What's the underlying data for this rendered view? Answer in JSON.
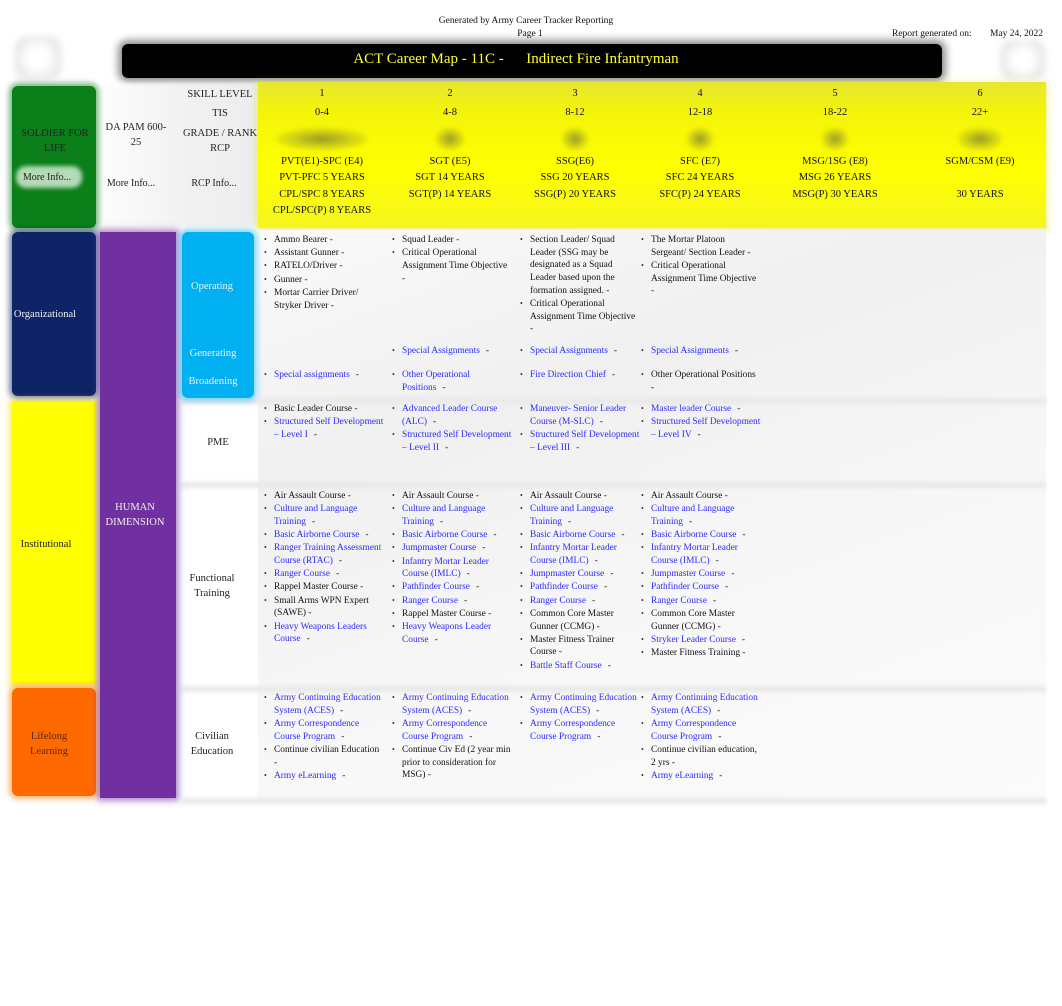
{
  "header": {
    "generated_by": "Generated by Army Career Tracker Reporting",
    "page": "Page 1",
    "report_generated_label": "Report generated on:",
    "report_date": "May 24, 2022",
    "title": "ACT Career Map - 11C -      Indirect Fire Infantryman"
  },
  "left_panel": {
    "soldier_for_life": "SOLDIER FOR LIFE",
    "sfl_more_info": "More Info...",
    "da_pam": "DA PAM 600-25",
    "da_pam_more_info": "More Info...",
    "row_labels": {
      "skill_level": "SKILL LEVEL",
      "tis": "TIS",
      "grade_rank": "GRADE / RANK",
      "rcp": "RCP",
      "rcp_info": "RCP Info..."
    },
    "organizational": "Organizational",
    "institutional": "Institutional",
    "lifelong_learning": "Lifelong Learning",
    "human_dimension": "HUMAN DIMENSION",
    "operating": "Operating",
    "generating": "Generating",
    "broadening": "Broadening",
    "pme": "PME",
    "functional_training": "Functional Training",
    "civilian_education": "Civilian Education"
  },
  "colors": {
    "soldier_for_life": "#0a7f1a",
    "organizational": "#0e2466",
    "institutional": "#ffff00",
    "lifelong_learning": "#ff6a00",
    "human_dimension": "#7030a0",
    "domain_cyan": "#00b0f0",
    "header_band": "#ffff00",
    "title_text": "#ffff33",
    "link": "#2a2aff"
  },
  "levels": [
    {
      "skill_level": "1",
      "tis": "0-4",
      "grade": "PVT(E1)-SPC (E4)",
      "rcp": [
        "PVT-PFC 5 YEARS",
        "CPL/SPC 8 YEARS",
        "CPL/SPC(P) 8 YEARS"
      ],
      "insignia": "rank-insignia-e1-e4"
    },
    {
      "skill_level": "2",
      "tis": "4-8",
      "grade": "SGT (E5)",
      "rcp": [
        "SGT  14 YEARS",
        "SGT(P) 14  YEARS"
      ],
      "insignia": "rank-insignia-e5"
    },
    {
      "skill_level": "3",
      "tis": "8-12",
      "grade": "SSG(E6)",
      "rcp": [
        "SSG 20 YEARS",
        "SSG(P) 20 YEARS"
      ],
      "insignia": "rank-insignia-e6"
    },
    {
      "skill_level": "4",
      "tis": "12-18",
      "grade": "SFC (E7)",
      "rcp": [
        "SFC 24 YEARS",
        "SFC(P) 24 YEARS"
      ],
      "insignia": "rank-insignia-e7"
    },
    {
      "skill_level": "5",
      "tis": "18-22",
      "grade": "MSG/1SG (E8)",
      "rcp": [
        "MSG 26 YEARS",
        "MSG(P) 30 YEARS"
      ],
      "insignia": "rank-insignia-e8"
    },
    {
      "skill_level": "6",
      "tis": "22+",
      "grade": "SGM/CSM (E9)",
      "rcp": [
        "",
        "30 YEARS"
      ],
      "insignia": "rank-insignia-e9"
    }
  ],
  "grid": {
    "operating": [
      [
        {
          "text": "Ammo Bearer -",
          "link": false
        },
        {
          "text": "Assistant Gunner -",
          "link": false
        },
        {
          "text": "RATELO/Driver -",
          "link": false
        },
        {
          "text": "Gunner -",
          "link": false
        },
        {
          "text": "Mortar Carrier Driver/ Stryker Driver -",
          "link": false
        }
      ],
      [
        {
          "text": "Squad Leader -",
          "link": false
        },
        {
          "text": "Critical Operational Assignment Time Objective -",
          "link": false
        }
      ],
      [
        {
          "text": "Section Leader/ Squad Leader (SSG may be designated as a Squad Leader based upon the formation assigned. -",
          "link": false
        },
        {
          "text": "Critical Operational Assignment Time Objective -",
          "link": false
        }
      ],
      [
        {
          "text": "The Mortar Platoon Sergeant/ Section Leader -",
          "link": false
        },
        {
          "text": "Critical Operational Assignment Time Objective -",
          "link": false
        }
      ]
    ],
    "generating": [
      [],
      [
        {
          "text": "Special Assignments",
          "link": true
        }
      ],
      [
        {
          "text": "Special Assignments",
          "link": true
        }
      ],
      [
        {
          "text": "Special Assignments",
          "link": true
        }
      ]
    ],
    "broadening": [
      [
        {
          "text": "Special assignments",
          "link": true
        }
      ],
      [
        {
          "text": "Other Operational Positions",
          "link": true
        }
      ],
      [
        {
          "text": "Fire Direction Chief",
          "link": true
        }
      ],
      [
        {
          "text": "Other Operational Positions -",
          "link": false
        }
      ]
    ],
    "pme": [
      [
        {
          "text": "Basic Leader Course -",
          "link": false
        },
        {
          "text": "Structured Self Development – Level I",
          "link": true
        }
      ],
      [
        {
          "text": "Advanced Leader Course (ALC)",
          "link": true
        },
        {
          "text": "Structured Self Development – Level II",
          "link": true
        }
      ],
      [
        {
          "text": "Maneuver- Senior Leader Course (M-SLC)",
          "link": true
        },
        {
          "text": "Structured Self Development – Level III",
          "link": true
        }
      ],
      [
        {
          "text": "Master leader Course",
          "link": true
        },
        {
          "text": "Structured Self Development – Level IV",
          "link": true
        }
      ]
    ],
    "functional_training": [
      [
        {
          "text": "Air Assault Course -",
          "link": false
        },
        {
          "text": "Culture and Language Training",
          "link": true
        },
        {
          "text": "Basic Airborne Course",
          "link": true
        },
        {
          "text": "Ranger Training Assessment Course (RTAC)",
          "link": true
        },
        {
          "text": "Ranger Course",
          "link": true
        },
        {
          "text": "Rappel Master Course -",
          "link": false
        },
        {
          "text": "Small Arms WPN Expert (SAWE) -",
          "link": false
        },
        {
          "text": "Heavy Weapons Leaders Course",
          "link": true
        }
      ],
      [
        {
          "text": "Air Assault Course -",
          "link": false
        },
        {
          "text": "Culture and Language Training",
          "link": true
        },
        {
          "text": "Basic Airborne Course",
          "link": true
        },
        {
          "text": "Jumpmaster Course",
          "link": true
        },
        {
          "text": "Infantry Mortar Leader Course (IMLC)",
          "link": true
        },
        {
          "text": "Pathfinder Course",
          "link": true
        },
        {
          "text": "Ranger Course",
          "link": true
        },
        {
          "text": "Rappel Master Course -",
          "link": false
        },
        {
          "text": "Heavy Weapons Leader Course",
          "link": true
        }
      ],
      [
        {
          "text": "Air Assault Course -",
          "link": false
        },
        {
          "text": "Culture and Language Training",
          "link": true
        },
        {
          "text": "Basic Airborne Course",
          "link": true
        },
        {
          "text": "Infantry Mortar Leader Course (IMLC)",
          "link": true
        },
        {
          "text": "Jumpmaster Course",
          "link": true
        },
        {
          "text": "Pathfinder Course",
          "link": true
        },
        {
          "text": "Ranger Course",
          "link": true
        },
        {
          "text": "Common Core Master Gunner (CCMG) -",
          "link": false
        },
        {
          "text": "Master Fitness Trainer Course -",
          "link": false
        },
        {
          "text": "Battle Staff Course",
          "link": true
        }
      ],
      [
        {
          "text": "Air Assault Course -",
          "link": false
        },
        {
          "text": "Culture and Language Training",
          "link": true
        },
        {
          "text": "Basic Airborne Course",
          "link": true
        },
        {
          "text": "Infantry Mortar Leader Course (IMLC)",
          "link": true
        },
        {
          "text": "Jumpmaster Course",
          "link": true
        },
        {
          "text": "Pathfinder Course",
          "link": true
        },
        {
          "text": "Ranger Course",
          "link": true
        },
        {
          "text": "Common Core Master Gunner (CCMG) -",
          "link": false
        },
        {
          "text": "Stryker Leader Course",
          "link": true
        },
        {
          "text": "Master Fitness Training -",
          "link": false
        }
      ]
    ],
    "civilian_education": [
      [
        {
          "text": "Army Continuing Education System (ACES)",
          "link": true
        },
        {
          "text": "Army Correspondence Course Program",
          "link": true
        },
        {
          "text": "Continue civilian Education -",
          "link": false
        },
        {
          "text": "Army eLearning",
          "link": true
        }
      ],
      [
        {
          "text": "Army Continuing Education System (ACES)",
          "link": true
        },
        {
          "text": "Army Correspondence Course Program",
          "link": true
        },
        {
          "text": "Continue Civ Ed (2 year min prior to consideration for MSG) -",
          "link": false
        }
      ],
      [
        {
          "text": "Army Continuing Education System (ACES)",
          "link": true
        },
        {
          "text": "Army Correspondence Course Program",
          "link": true
        }
      ],
      [
        {
          "text": "Army Continuing Education System (ACES)",
          "link": true
        },
        {
          "text": "Army Correspondence Course Program",
          "link": true
        },
        {
          "text": "Continue civilian education, 2 yrs -",
          "link": false
        },
        {
          "text": "Army eLearning",
          "link": true
        }
      ]
    ]
  }
}
